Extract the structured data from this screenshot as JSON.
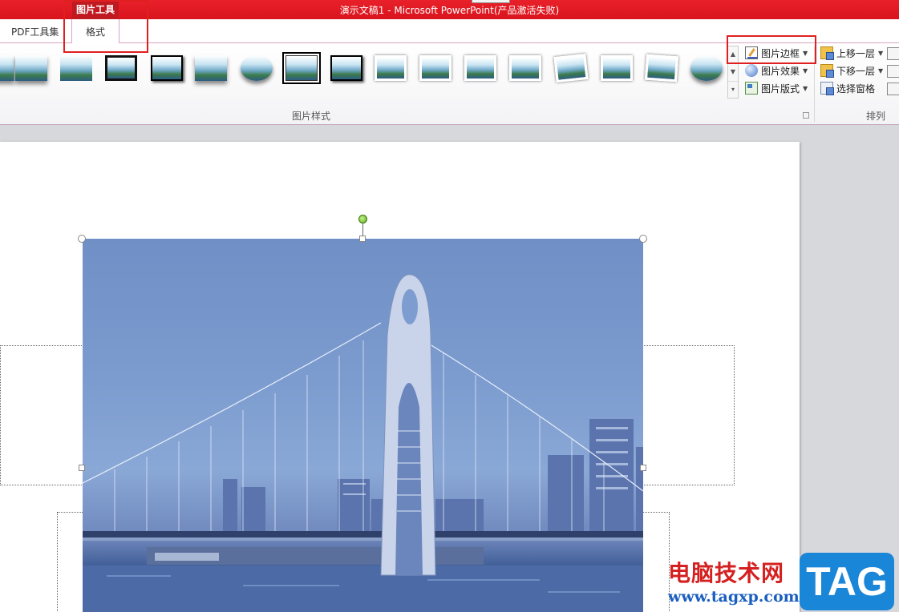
{
  "titlebar": {
    "context_group": "图片工具",
    "title": "演示文稿1 - Microsoft PowerPoint(产品激活失败)"
  },
  "tabs": {
    "pdf": "PDF工具集",
    "format": "格式"
  },
  "ribbon": {
    "picture_styles": {
      "group_label": "图片样式",
      "picture_border": "图片边框",
      "picture_effects": "图片效果",
      "picture_layout": "图片版式"
    },
    "arrange": {
      "group_label": "排列",
      "bring_forward": "上移一层",
      "send_backward": "下移一层",
      "selection_pane": "选择窗格"
    }
  },
  "watermark": {
    "site_name": "电脑技术网",
    "url": "www.tagxp.com",
    "badge": "TAG"
  },
  "colors": {
    "titlebar": "#e0181f",
    "highlight": "#e02020",
    "tab_border": "#d7a3c4"
  }
}
